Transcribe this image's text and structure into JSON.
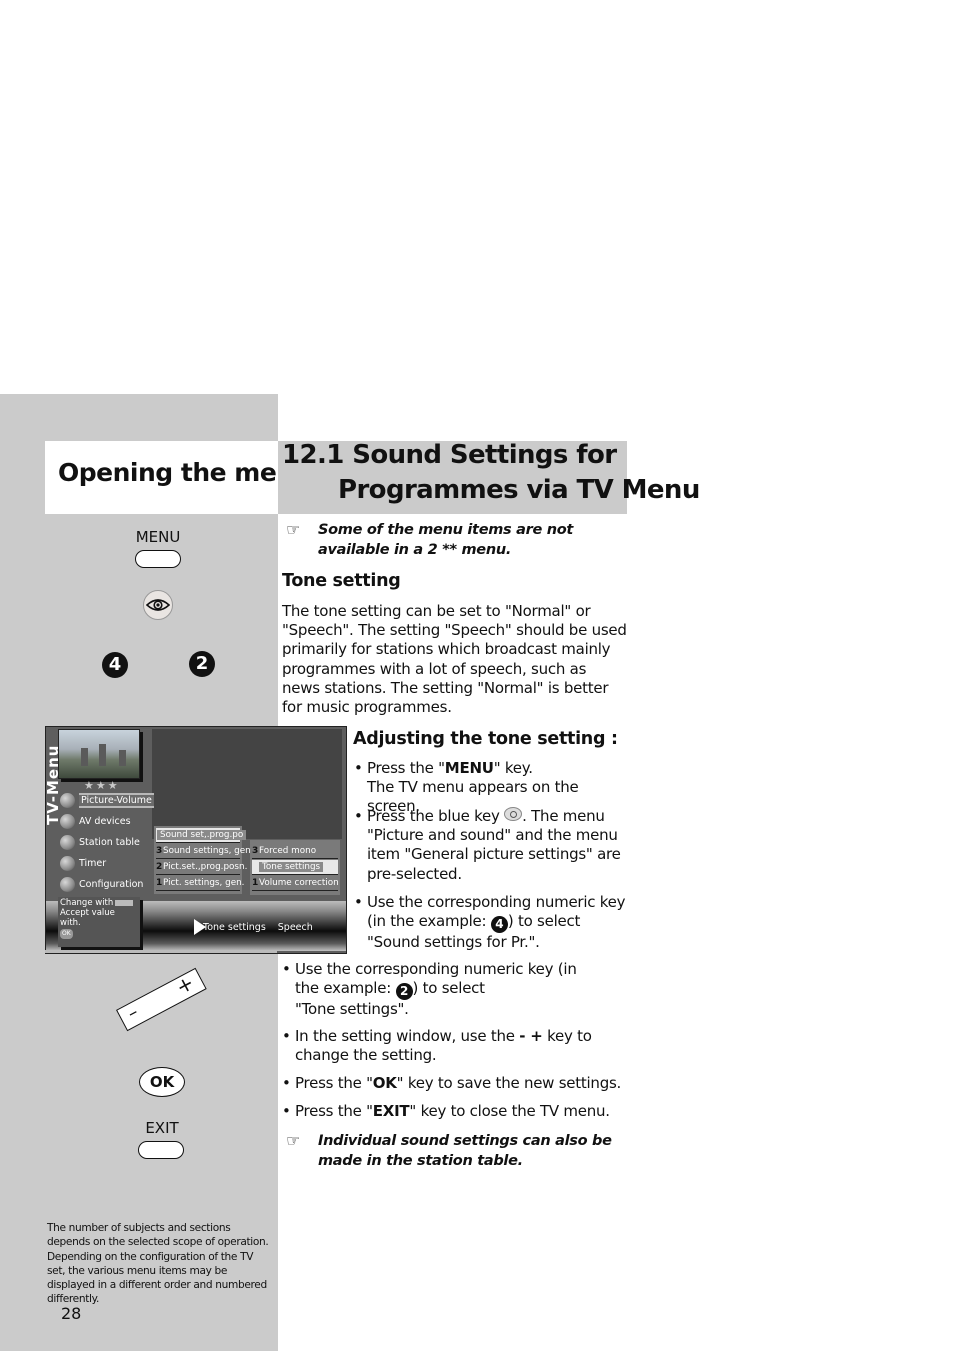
{
  "page": {
    "number": "28"
  },
  "sidebar": {
    "title": "Opening the menu",
    "keys": {
      "menu_label": "MENU",
      "eye_icon": "eye-icon",
      "num_left": "4",
      "num_right": "2",
      "minus": "–",
      "plus": "+",
      "ok": "OK",
      "exit_label": "EXIT"
    },
    "footnote": "The number of subjects and sections depends on the selected scope of operation. Depending on the configuration of the TV set, the various menu items may be displayed in a different order and numbered differently."
  },
  "heading": {
    "line1": "12.1 Sound Settings for",
    "line2": "Programmes via TV Menu"
  },
  "notes": {
    "note1": "Some of the menu items are not available in a 2 ** menu.",
    "note2": "Individual sound settings can also be made in the station table.",
    "icon": "☞"
  },
  "tone_section": {
    "heading": "Tone setting",
    "paragraph": "The tone setting can be set to \"Normal\" or \"Speech\". The setting \"Speech\" should be used primarily for stations which broadcast mainly programmes with a lot of speech, such as news stations. The setting \"Normal\" is better for music programmes."
  },
  "adjust_section": {
    "heading": "Adjusting the tone setting :",
    "bullet_char": "•",
    "steps": [
      {
        "pre": "Press the \"",
        "bold": "MENU",
        "post": "\" key.",
        "line2": "The TV menu appears on the screen."
      },
      {
        "pre": "Press the blue key ",
        "post": ". The menu \"Picture and sound\" and the menu item \"General picture settings\" are pre-selected."
      },
      {
        "pre": "Use the corresponding numeric key (in the example: ",
        "num": "4",
        "post": ") to select \"Sound settings for Pr.\"."
      },
      {
        "pre": "Use the corresponding numeric key (in the example: ",
        "num": "2",
        "post": ") to select",
        "line2": "\"Tone settings\"."
      },
      {
        "pre": "In the setting window, use the ",
        "keys": "- +",
        "post": " key to change the setting."
      },
      {
        "pre": "Press the \"",
        "bold": "OK",
        "post": "\" key to save the new settings."
      },
      {
        "pre": "Press the \"",
        "bold": "EXIT",
        "post": "\" key to close the TV menu."
      }
    ]
  },
  "tv_screen": {
    "vertical_title": "TV-Menu",
    "stars": "★★★",
    "menu_items": [
      {
        "label": "Picture-Volume",
        "selected": true
      },
      {
        "label": "AV devices"
      },
      {
        "label": "Station table"
      },
      {
        "label": "Timer"
      },
      {
        "label": "Configuration"
      }
    ],
    "submenu1": [
      {
        "num": "",
        "label": "Sound set,.prog.po",
        "highlighted": true
      },
      {
        "num": "3",
        "label": "Sound settings, gen."
      },
      {
        "num": "2",
        "label": "Pict.set.,prog.posn."
      },
      {
        "num": "1",
        "label": "Pict. settings, gen."
      }
    ],
    "submenu2": [
      {
        "num": "3",
        "label": "Forced mono"
      },
      {
        "num": "",
        "label": "Tone settings",
        "highlighted": true
      },
      {
        "num": "1",
        "label": "Volume correction"
      }
    ],
    "help": {
      "line1": "Change with",
      "line2": "Accept value with.",
      "ok": "OK"
    },
    "status": {
      "label": "Tone settings",
      "value": "Speech"
    }
  }
}
